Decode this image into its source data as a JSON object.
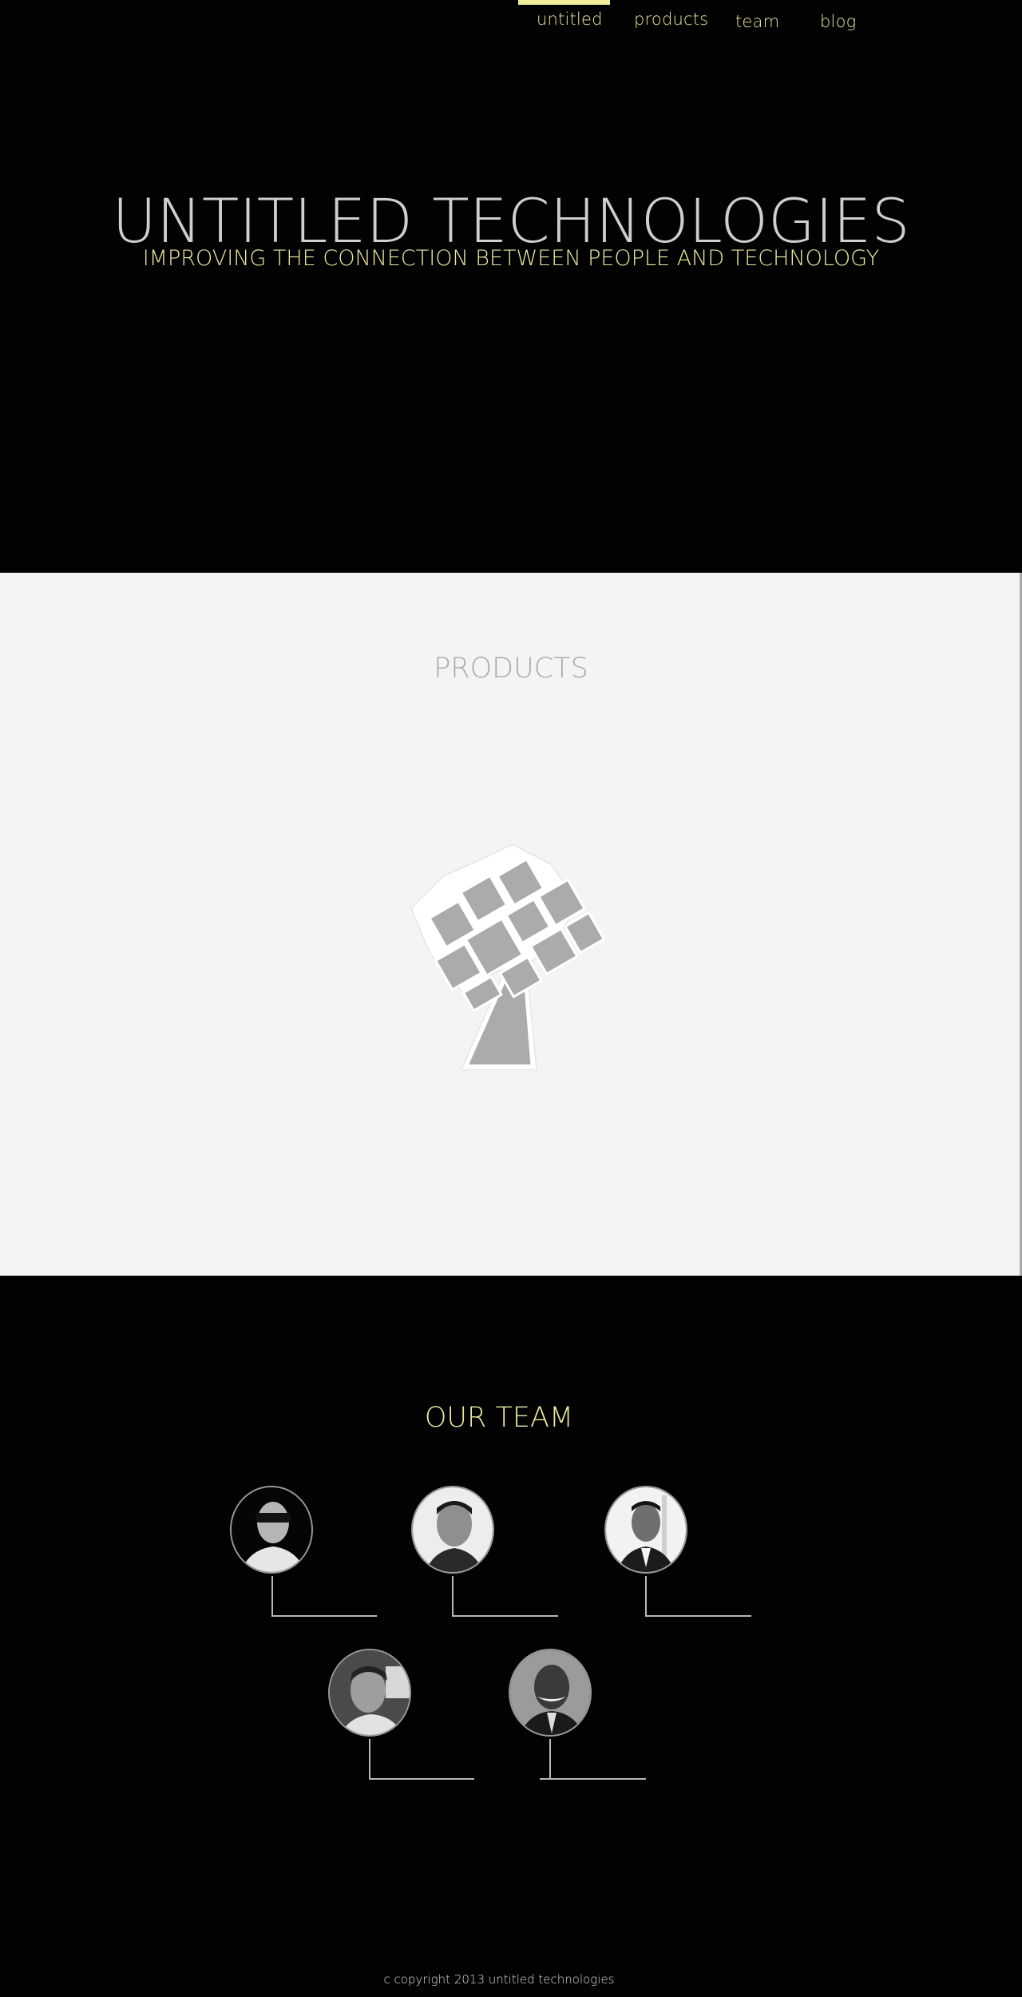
{
  "nav": {
    "items": [
      {
        "label": "untitled",
        "active": true
      },
      {
        "label": "products",
        "active": false
      },
      {
        "label": "team",
        "active": false
      },
      {
        "label": "blog",
        "active": false
      }
    ]
  },
  "hero": {
    "title": "UNTITLED TECHNOLOGIES",
    "subtitle": "IMPROVING THE CONNECTION BETWEEN PEOPLE AND TECHNOLOGY"
  },
  "products": {
    "title": "PRODUCTS",
    "logo_icon": "tree-logo-icon"
  },
  "team": {
    "title": "OUR TEAM",
    "members": [
      {
        "photo": "team-member-1-photo"
      },
      {
        "photo": "team-member-2-photo"
      },
      {
        "photo": "team-member-3-photo"
      },
      {
        "photo": "team-member-4-photo"
      },
      {
        "photo": "team-member-5-photo"
      }
    ]
  },
  "footer": {
    "copyright": "c copyright 2013 untitled technologies"
  },
  "colors": {
    "accent_yellow": "#eceaa0",
    "dark_bg": "#020202",
    "light_bg": "#f4f4f4",
    "gray_text": "#a9a9a9"
  }
}
